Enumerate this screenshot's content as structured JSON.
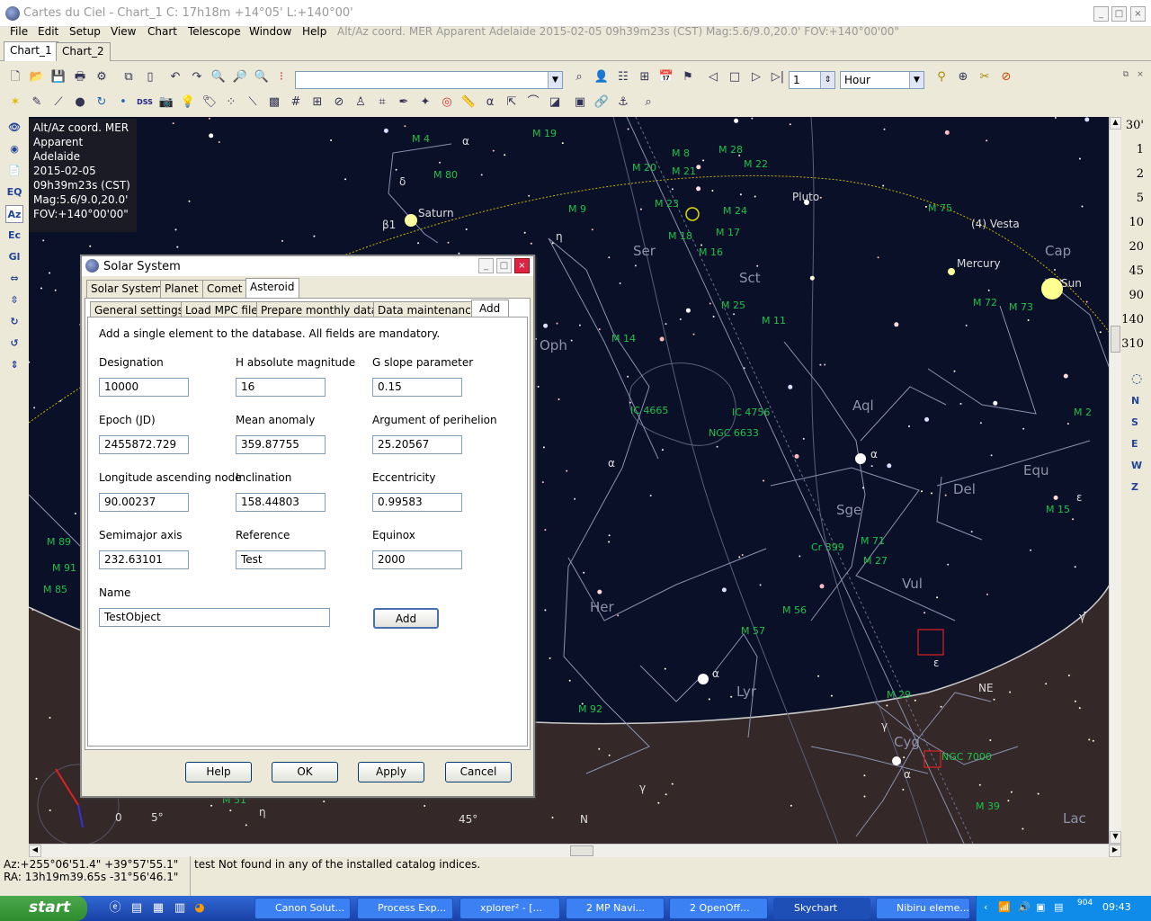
{
  "window": {
    "title": "Cartes du Ciel - Chart_1  C: 17h18m +14°05' L:+140°00'"
  },
  "menu": {
    "items": [
      "File",
      "Edit",
      "Setup",
      "View",
      "Chart",
      "Telescope",
      "Window",
      "Help"
    ],
    "info": "Alt/Az coord. MER Apparent Adelaide 2015-02-05 09h39m23s (CST) Mag:5.6/9.0,20.0' FOV:+140°00'00\""
  },
  "chart_tabs": [
    "Chart_1",
    "Chart_2"
  ],
  "toolbar": {
    "object_combo": "",
    "step_value": "1",
    "step_unit": "Hour"
  },
  "left_toolbar": [
    "EQ",
    "Az",
    "Ec",
    "Gl"
  ],
  "info_box": {
    "lines": [
      "Alt/Az coord. MER",
      "Apparent",
      "Adelaide",
      "2015-02-05",
      "09h39m23s (CST)",
      "Mag:5.6/9.0,20.0'",
      "FOV:+140°00'00\""
    ]
  },
  "right_scale": {
    "values": [
      "30'",
      "1",
      "2",
      "5",
      "10",
      "20",
      "45",
      "90",
      "140",
      "310"
    ],
    "directions": [
      "N",
      "S",
      "E",
      "W",
      "Z"
    ]
  },
  "sky": {
    "constellations": [
      "Ser",
      "Sct",
      "Oph",
      "Aql",
      "Equ",
      "Del",
      "Sge",
      "Vul",
      "Her",
      "Lyr",
      "Cyg",
      "Lac",
      "Cap"
    ],
    "objects": [
      "M 4",
      "M 19",
      "M 8",
      "M 28",
      "M 22",
      "M 20",
      "M 21",
      "M 23",
      "M 24",
      "M 17",
      "M 18",
      "M 16",
      "M 9",
      "M 80",
      "M 25",
      "M 11",
      "M 14",
      "IC 4665",
      "IC 4756",
      "NGC 6633",
      "M 2",
      "M 15",
      "Cr 399",
      "M 71",
      "M 27",
      "M 56",
      "M 57",
      "M 29",
      "M 92",
      "NGC 7000",
      "M 39",
      "M 72",
      "M 73",
      "M 75",
      "M 89",
      "M 91",
      "M 85",
      "M 51"
    ],
    "bodies": [
      "Saturn",
      "Pluto",
      "(4) Vesta",
      "Mercury",
      "Sun"
    ],
    "greek": [
      "α",
      "δ",
      "β1",
      "η",
      "α",
      "α",
      "α",
      "ε",
      "γ",
      "α",
      "γ",
      "η",
      "ε",
      "γ"
    ],
    "horizon": [
      "NE",
      "N",
      "0",
      "5°",
      "45°"
    ]
  },
  "dialog": {
    "title": "Solar System",
    "tabs": [
      "Solar System",
      "Planet",
      "Comet",
      "Asteroid"
    ],
    "subtabs": [
      "General settings",
      "Load MPC file",
      "Prepare monthly data",
      "Data maintenance",
      "Add"
    ],
    "intro": "Add a single element to the database. All fields are mandatory.",
    "fields": {
      "designation": {
        "label": "Designation",
        "value": "10000"
      },
      "h_mag": {
        "label": "H absolute magnitude",
        "value": "16"
      },
      "g_slope": {
        "label": "G slope parameter",
        "value": "0.15"
      },
      "epoch": {
        "label": "Epoch (JD)",
        "value": "2455872.729"
      },
      "mean_anomaly": {
        "label": "Mean anomaly",
        "value": "359.87755"
      },
      "arg_peri": {
        "label": "Argument of perihelion",
        "value": "25.20567"
      },
      "lon_node": {
        "label": "Longitude ascending node",
        "value": "90.00237"
      },
      "inclination": {
        "label": "Inclination",
        "value": "158.44803"
      },
      "eccentricity": {
        "label": "Eccentricity",
        "value": "0.99583"
      },
      "semimajor": {
        "label": "Semimajor axis",
        "value": "232.63101"
      },
      "reference": {
        "label": "Reference",
        "value": "Test"
      },
      "equinox": {
        "label": "Equinox",
        "value": "2000"
      },
      "name": {
        "label": "Name",
        "value": "TestObject"
      }
    },
    "add_button": "Add",
    "buttons": {
      "help": "Help",
      "ok": "OK",
      "apply": "Apply",
      "cancel": "Cancel"
    }
  },
  "status": {
    "az": "Az:+255°06'51.4\" +39°57'55.1\"",
    "ra": "RA: 13h19m39.65s -31°56'46.1\"",
    "message": "test  Not found in any of the installed catalog indices."
  },
  "taskbar": {
    "start": "start",
    "tasks": [
      "Canon Solut...",
      "Process Exp...",
      "xplorer² - [...",
      "2 MP Navi...",
      "2 OpenOff...",
      "Skychart",
      "Nibiru eleme..."
    ],
    "clock": "09:43",
    "tray_number": "904"
  },
  "colors": {
    "sky": "#0b1029",
    "ground": "#3a2a2a",
    "ecliptic": "#c9b400",
    "labels": "#1fc14a"
  }
}
